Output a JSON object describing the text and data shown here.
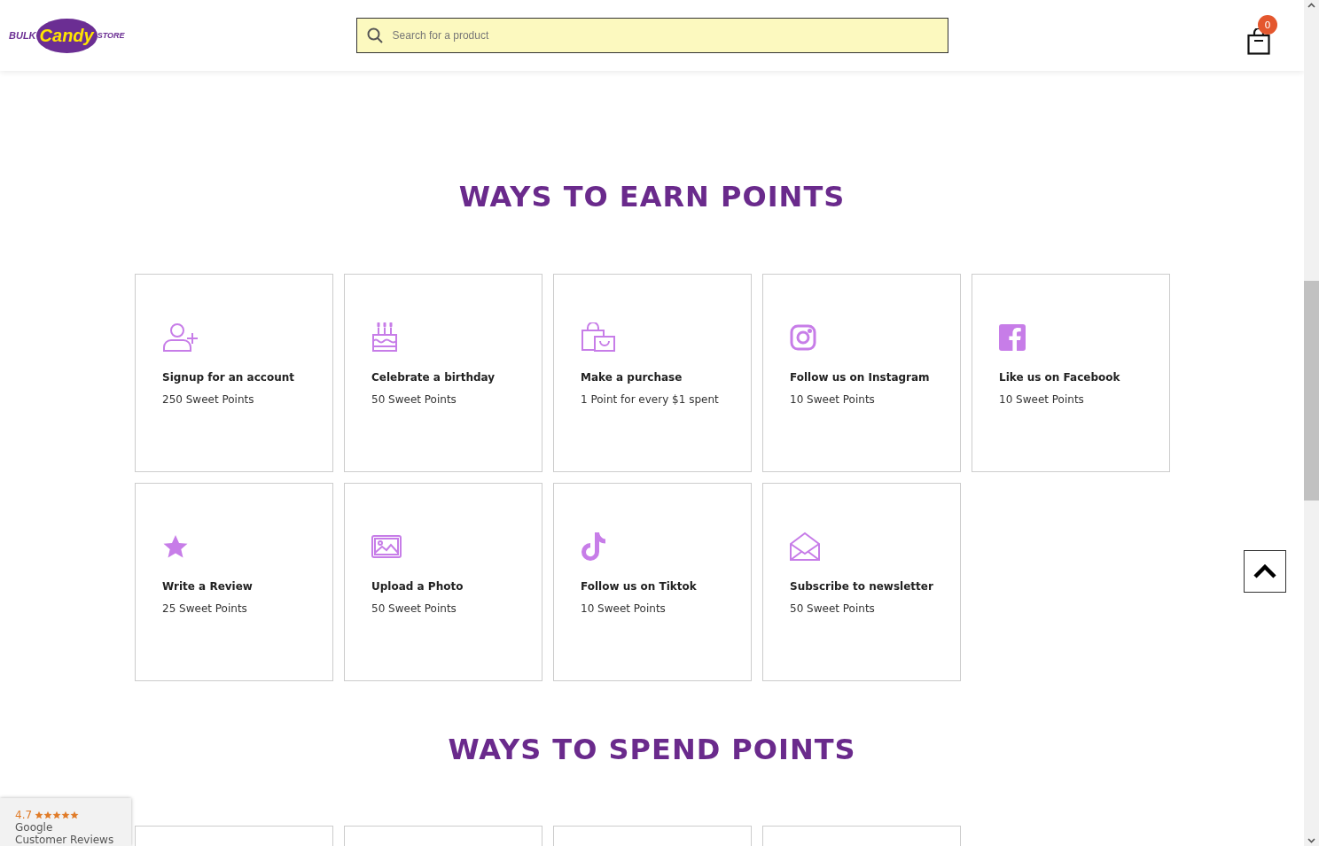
{
  "header": {
    "logo": {
      "word_1": "BULK",
      "word_2": "Candy",
      "word_3": "STORE"
    },
    "search": {
      "placeholder": "Search for a product"
    },
    "cart": {
      "count": "0"
    }
  },
  "earn": {
    "title": "WAYS TO EARN POINTS",
    "cards": [
      {
        "kind": "user-plus",
        "title": "Signup for an account",
        "points": "250 Sweet Points"
      },
      {
        "kind": "cake",
        "title": "Celebrate a birthday",
        "points": "50 Sweet Points"
      },
      {
        "kind": "bag",
        "title": "Make a purchase",
        "points": "1 Point for every $1 spent"
      },
      {
        "kind": "instagram",
        "title": "Follow us on Instagram",
        "points": "10 Sweet Points"
      },
      {
        "kind": "facebook",
        "title": "Like us on Facebook",
        "points": "10 Sweet Points"
      },
      {
        "kind": "star",
        "title": "Write a Review",
        "points": "25 Sweet Points"
      },
      {
        "kind": "image",
        "title": "Upload a Photo",
        "points": "50 Sweet Points"
      },
      {
        "kind": "tiktok",
        "title": "Follow us on Tiktok",
        "points": "10 Sweet Points"
      },
      {
        "kind": "envelope",
        "title": "Subscribe to newsletter",
        "points": "50 Sweet Points"
      }
    ]
  },
  "spend": {
    "title": "WAYS TO SPEND POINTS",
    "cards": [
      {
        "kind": "reward"
      },
      {
        "kind": "reward"
      },
      {
        "kind": "reward"
      },
      {
        "kind": "reward"
      }
    ]
  },
  "reviews_badge": {
    "rating": "4.7",
    "stars": 5,
    "source": "Google",
    "caption": "Customer Reviews"
  }
}
